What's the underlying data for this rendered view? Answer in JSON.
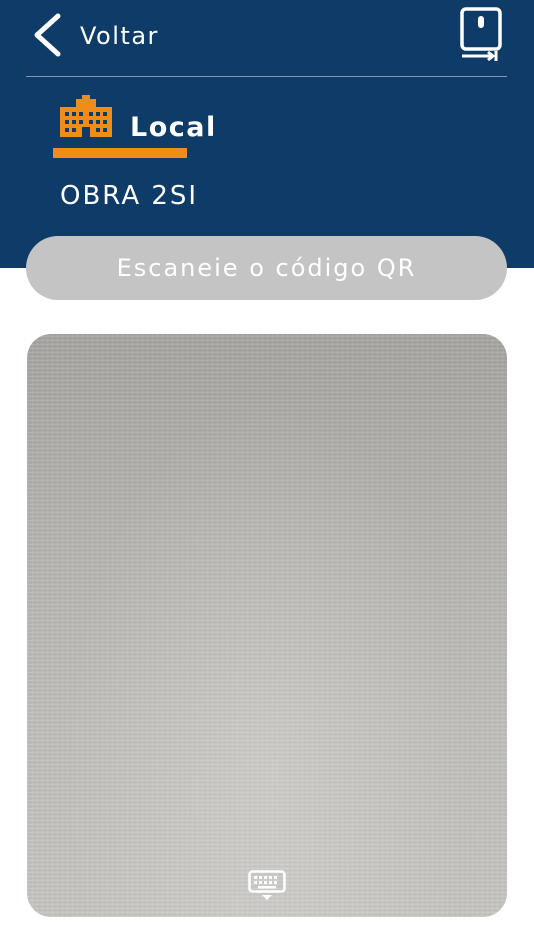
{
  "header": {
    "back_label": "Voltar",
    "back_icon": "chevron-left-icon",
    "device_icon": "device-transfer-icon"
  },
  "location": {
    "icon": "building-icon",
    "title": "Local",
    "site_name": "OBRA 2SI"
  },
  "scan": {
    "instruction": "Escaneie o código QR"
  },
  "camera": {
    "keyboard_icon": "keyboard-icon"
  },
  "colors": {
    "header_bg": "#0f3b69",
    "accent": "#f08c1a",
    "pill_bg": "#c4c4c4",
    "text_light": "#ffffff"
  }
}
